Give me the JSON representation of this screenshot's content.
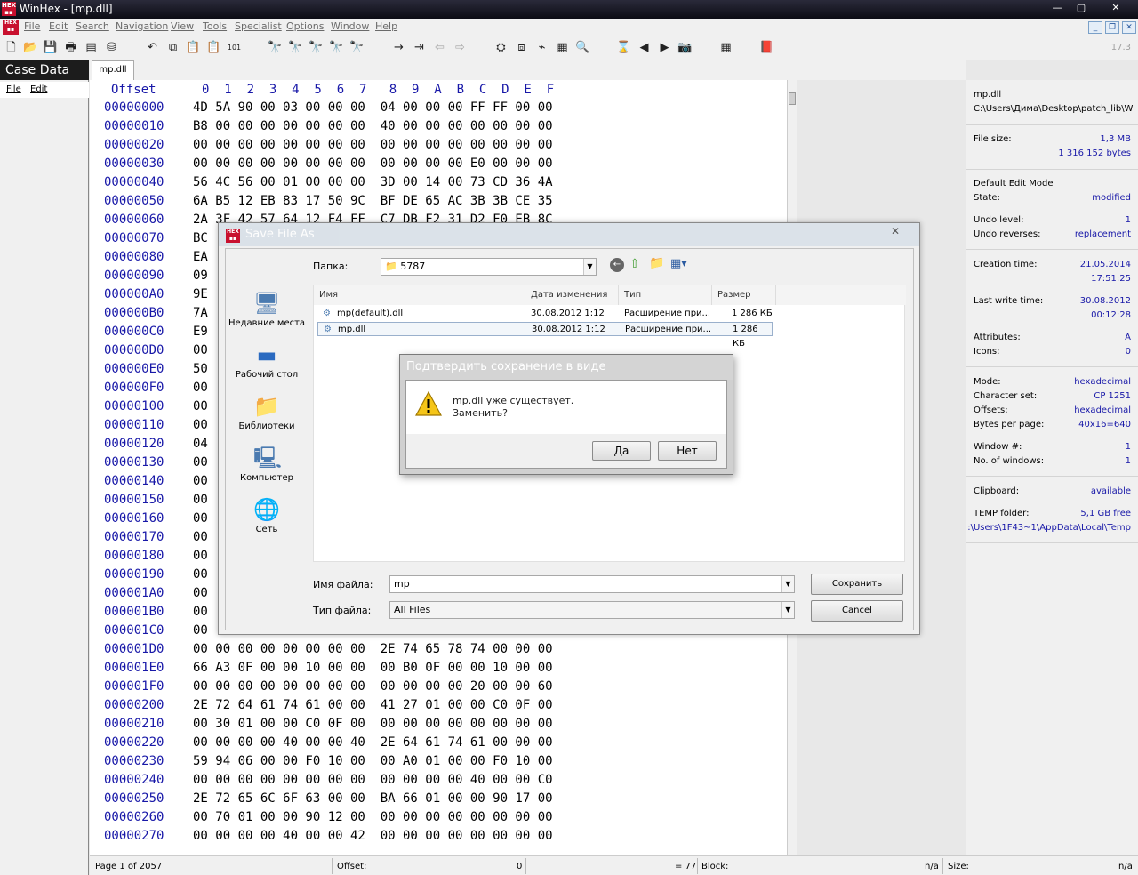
{
  "window": {
    "title": "WinHex - [mp.dll]",
    "controls": [
      "—",
      "▢",
      "✕"
    ]
  },
  "menu": {
    "items": [
      "File",
      "Edit",
      "Search",
      "Navigation",
      "View",
      "Tools",
      "Specialist",
      "Options",
      "Window",
      "Help"
    ]
  },
  "toolbar": {
    "version": "17.3"
  },
  "case_panel": {
    "title": "Case Data",
    "menu": [
      "File",
      "Edit"
    ]
  },
  "tab": {
    "label": "mp.dll"
  },
  "hex": {
    "header_offset": "Offset",
    "header_cols": "0  1  2  3  4  5  6  7   8  9  A  B  C  D  E  F",
    "rows": [
      {
        "off": "00000000",
        "bytes": "4D 5A 90 00 03 00 00 00  04 00 00 00 FF FF 00 00"
      },
      {
        "off": "00000010",
        "bytes": "B8 00 00 00 00 00 00 00  40 00 00 00 00 00 00 00"
      },
      {
        "off": "00000020",
        "bytes": "00 00 00 00 00 00 00 00  00 00 00 00 00 00 00 00"
      },
      {
        "off": "00000030",
        "bytes": "00 00 00 00 00 00 00 00  00 00 00 00 E0 00 00 00"
      },
      {
        "off": "00000040",
        "bytes": "56 4C 56 00 01 00 00 00  3D 00 14 00 73 CD 36 4A"
      },
      {
        "off": "00000050",
        "bytes": "6A B5 12 EB 83 17 50 9C  BF DE 65 AC 3B 3B CE 35"
      },
      {
        "off": "00000060",
        "bytes": "2A 3F 42 57 64 12 F4 FF  C7 DB F2 31 D2 F0 EB 8C"
      },
      {
        "off": "00000070",
        "bytes": "BC"
      },
      {
        "off": "00000080",
        "bytes": "EA"
      },
      {
        "off": "00000090",
        "bytes": "09"
      },
      {
        "off": "000000A0",
        "bytes": "9E"
      },
      {
        "off": "000000B0",
        "bytes": "7A"
      },
      {
        "off": "000000C0",
        "bytes": "E9"
      },
      {
        "off": "000000D0",
        "bytes": "00"
      },
      {
        "off": "000000E0",
        "bytes": "50"
      },
      {
        "off": "000000F0",
        "bytes": "00"
      },
      {
        "off": "00000100",
        "bytes": "00"
      },
      {
        "off": "00000110",
        "bytes": "00"
      },
      {
        "off": "00000120",
        "bytes": "04"
      },
      {
        "off": "00000130",
        "bytes": "00"
      },
      {
        "off": "00000140",
        "bytes": "00"
      },
      {
        "off": "00000150",
        "bytes": "00"
      },
      {
        "off": "00000160",
        "bytes": "00"
      },
      {
        "off": "00000170",
        "bytes": "00"
      },
      {
        "off": "00000180",
        "bytes": "00"
      },
      {
        "off": "00000190",
        "bytes": "00"
      },
      {
        "off": "000001A0",
        "bytes": "00"
      },
      {
        "off": "000001B0",
        "bytes": "00"
      },
      {
        "off": "000001C0",
        "bytes": "00"
      },
      {
        "off": "000001D0",
        "bytes": "00 00 00 00 00 00 00 00  2E 74 65 78 74 00 00 00"
      },
      {
        "off": "000001E0",
        "bytes": "66 A3 0F 00 00 10 00 00  00 B0 0F 00 00 10 00 00"
      },
      {
        "off": "000001F0",
        "bytes": "00 00 00 00 00 00 00 00  00 00 00 00 20 00 00 60"
      },
      {
        "off": "00000200",
        "bytes": "2E 72 64 61 74 61 00 00  41 27 01 00 00 C0 0F 00"
      },
      {
        "off": "00000210",
        "bytes": "00 30 01 00 00 C0 0F 00  00 00 00 00 00 00 00 00"
      },
      {
        "off": "00000220",
        "bytes": "00 00 00 00 40 00 00 40  2E 64 61 74 61 00 00 00"
      },
      {
        "off": "00000230",
        "bytes": "59 94 06 00 00 F0 10 00  00 A0 01 00 00 F0 10 00"
      },
      {
        "off": "00000240",
        "bytes": "00 00 00 00 00 00 00 00  00 00 00 00 40 00 00 C0"
      },
      {
        "off": "00000250",
        "bytes": "2E 72 65 6C 6F 63 00 00  BA 66 01 00 00 90 17 00"
      },
      {
        "off": "00000260",
        "bytes": "00 70 01 00 00 90 12 00  00 00 00 00 00 00 00 00"
      },
      {
        "off": "00000270",
        "bytes": "00 00 00 00 40 00 00 42  00 00 00 00 00 00 00 00"
      }
    ]
  },
  "info": {
    "filename": "mp.dll",
    "path": "C:\\Users\\Дима\\Desktop\\patch_lib\\W",
    "file_size_label": "File size:",
    "file_size_mb": "1,3 MB",
    "file_size_bytes": "1 316 152 bytes",
    "edit_mode": "Default Edit Mode",
    "state_label": "State:",
    "state": "modified",
    "undo_level_label": "Undo level:",
    "undo_level": "1",
    "undo_rev_label": "Undo reverses:",
    "undo_rev": "replacement",
    "ctime_label": "Creation time:",
    "ctime_date": "21.05.2014",
    "ctime_time": "17:51:25",
    "wtime_label": "Last write time:",
    "wtime_date": "30.08.2012",
    "wtime_time": "00:12:28",
    "attr_label": "Attributes:",
    "attr": "A",
    "icons_label": "Icons:",
    "icons": "0",
    "mode_label": "Mode:",
    "mode": "hexadecimal",
    "charset_label": "Character set:",
    "charset": "CP 1251",
    "offsets_label": "Offsets:",
    "offsets": "hexadecimal",
    "bpp_label": "Bytes per page:",
    "bpp": "40x16=640",
    "winnum_label": "Window #:",
    "winnum": "1",
    "nwin_label": "No. of windows:",
    "nwin": "1",
    "clip_label": "Clipboard:",
    "clip": "available",
    "temp_label": "TEMP folder:",
    "temp_free": "5,1 GB free",
    "temp_path": ":\\Users\\1F43~1\\AppData\\Local\\Temp"
  },
  "status": {
    "page": "Page 1 of 2057",
    "offset_label": "Offset:",
    "offset": "0",
    "eq": "= 77",
    "block_label": "Block:",
    "block": "n/a",
    "size_label": "Size:",
    "size": "n/a"
  },
  "save_dialog": {
    "title": "Save File As",
    "folder_label": "Папка:",
    "folder": "5787",
    "places": [
      "Недавние места",
      "Рабочий стол",
      "Библиотеки",
      "Компьютер",
      "Сеть"
    ],
    "columns": [
      "Имя",
      "Дата изменения",
      "Тип",
      "Размер"
    ],
    "files": [
      {
        "name": "mp(default).dll",
        "date": "30.08.2012 1:12",
        "type": "Расширение при...",
        "size": "1 286 КБ"
      },
      {
        "name": "mp.dll",
        "date": "30.08.2012 1:12",
        "type": "Расширение при...",
        "size": "1 286 КБ"
      }
    ],
    "filename_label": "Имя файла:",
    "filename": "mp",
    "filetype_label": "Тип файла:",
    "filetype": "All Files",
    "save_btn": "Сохранить",
    "cancel_btn": "Cancel"
  },
  "confirm": {
    "title": "Подтвердить сохранение в виде",
    "line1": "mp.dll уже существует.",
    "line2": "Заменить?",
    "yes": "Да",
    "no": "Нет"
  }
}
